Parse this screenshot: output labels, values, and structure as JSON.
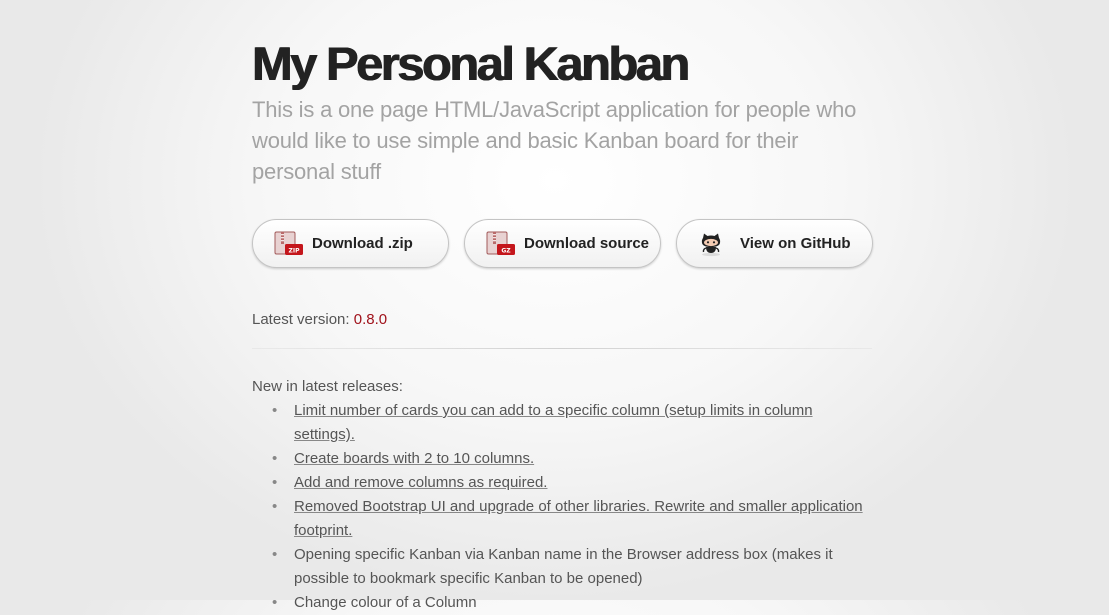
{
  "header": {
    "title": "My Personal Kanban",
    "tagline": "This is a one page HTML/JavaScript application for people who would like to use simple and basic Kanban board for their personal stuff"
  },
  "buttons": [
    {
      "label": "Download .zip",
      "icon": "zip-archive-icon"
    },
    {
      "label": "Download source",
      "icon": "gz-archive-icon"
    },
    {
      "label": "View on GitHub",
      "icon": "octocat-icon"
    }
  ],
  "version": {
    "label": "Latest version:",
    "value": "0.8.0"
  },
  "releases": {
    "heading": "New in latest releases:",
    "items": [
      {
        "text": "Limit number of cards you can add to a specific column (setup limits in column settings).",
        "link": true
      },
      {
        "text": "Create boards with 2 to 10 columns.",
        "link": true
      },
      {
        "text": "Add and remove columns as required.",
        "link": true
      },
      {
        "text": "Removed Bootstrap UI and upgrade of other libraries. Rewrite and smaller application footprint.",
        "link": true
      },
      {
        "text": "Opening specific Kanban via Kanban name in the Browser address box (makes it possible to bookmark specific Kanban to be opened)",
        "link": false
      },
      {
        "text": "Change colour of a Column",
        "link": false
      }
    ]
  },
  "colors": {
    "title": "#222222",
    "tagline": "#a3a3a3",
    "version_accent": "#a0121b",
    "text": "#555555"
  }
}
